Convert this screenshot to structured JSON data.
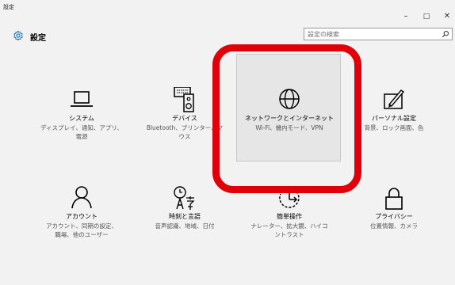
{
  "window": {
    "title": "設定",
    "minimize": "–",
    "maximize": "□",
    "close": "✕"
  },
  "header": {
    "title": "設定",
    "search_placeholder": "設定の検索"
  },
  "tiles": [
    {
      "name": "システム",
      "desc1": "ディスプレイ、通知、アプリ、",
      "desc2": "電源",
      "icon": "laptop-icon"
    },
    {
      "name": "デバイス",
      "desc1": "Bluetooth、プリンター、マ",
      "desc2": "ウス",
      "icon": "devices-icon"
    },
    {
      "name": "ネットワークとインターネット",
      "desc1": "Wi-Fi、機内モード、VPN",
      "desc2": "",
      "icon": "globe-icon"
    },
    {
      "name": "パーソナル設定",
      "desc1": "背景、ロック画面、色",
      "desc2": "",
      "icon": "personalization-icon"
    },
    {
      "name": "アカウント",
      "desc1": "アカウント、同期の設定、",
      "desc2": "職場、他のユーザー",
      "icon": "person-icon"
    },
    {
      "name": "時刻と言語",
      "desc1": "音声認識、地域、日付",
      "desc2": "",
      "icon": "time-language-icon"
    },
    {
      "name": "簡単操作",
      "desc1": "ナレーター、拡大鏡、ハイコ",
      "desc2": "ントラスト",
      "icon": "ease-of-access-icon"
    },
    {
      "name": "プライバシー",
      "desc1": "位置情報、カメラ",
      "desc2": "",
      "icon": "lock-icon"
    }
  ],
  "colors": {
    "background": "#f2f2f2",
    "highlight": "#e0000a",
    "accent": "#1a1a1a"
  }
}
